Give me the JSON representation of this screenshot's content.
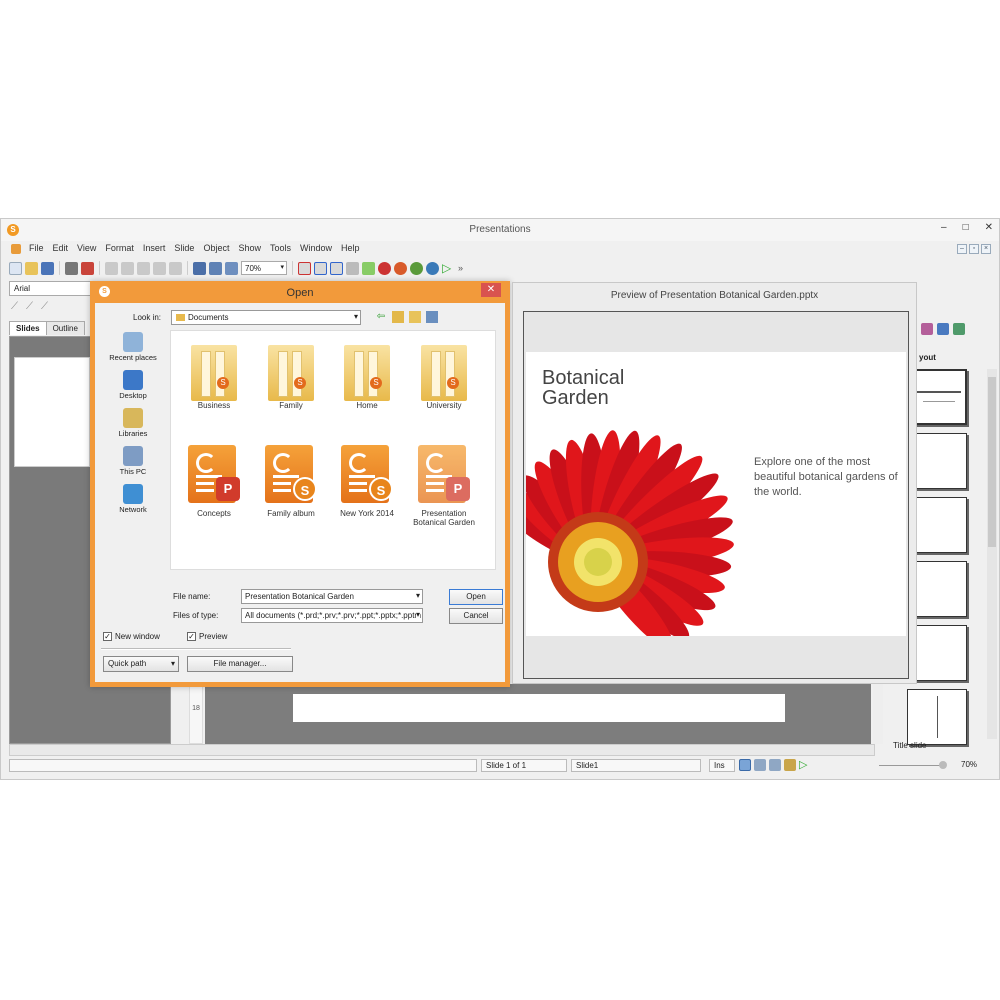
{
  "app": {
    "logo_letter": "S",
    "title": "Presentations",
    "window_buttons": [
      "–",
      "□",
      "✕"
    ],
    "mdi_buttons": [
      "–",
      "▫",
      "×"
    ]
  },
  "menu": {
    "items": [
      "File",
      "Edit",
      "View",
      "Format",
      "Insert",
      "Slide",
      "Object",
      "Show",
      "Tools",
      "Window",
      "Help"
    ]
  },
  "toolbar": {
    "zoom_value": "70%",
    "overflow": "»"
  },
  "format_bar": {
    "font": "Arial"
  },
  "panes": {
    "tabs": [
      "Slides",
      "Outline"
    ],
    "ruler_number": "18"
  },
  "layout_panel": {
    "title": "yout",
    "selected_label": "Title slide"
  },
  "statusbar": {
    "slide_of": "Slide 1 of 1",
    "slide_name": "Slide1",
    "mode": "Ins",
    "zoom": "70%"
  },
  "dialog": {
    "title": "Open",
    "logo_letter": "S",
    "close": "✕",
    "look_in_label": "Look in:",
    "look_in_value": "Documents",
    "places": [
      {
        "label": "Recent places",
        "color": "#8fb3d9"
      },
      {
        "label": "Desktop",
        "color": "#3c78c8"
      },
      {
        "label": "Libraries",
        "color": "#d8b75b"
      },
      {
        "label": "This PC",
        "color": "#7e9cc4"
      },
      {
        "label": "Network",
        "color": "#3f8fd3"
      }
    ],
    "folders": [
      "Business",
      "Family",
      "Home",
      "University"
    ],
    "documents": [
      {
        "label": "Concepts",
        "badge": "P"
      },
      {
        "label": "Family album",
        "badge": "S"
      },
      {
        "label": "New York 2014",
        "badge": "S"
      },
      {
        "label": "Presentation Botanical Garden",
        "badge": "P"
      }
    ],
    "file_name_label": "File name:",
    "file_name_value": "Presentation Botanical Garden",
    "file_type_label": "Files of type:",
    "file_type_value": "All documents (*.prd;*.prv;*.prv;*.ppt;*.pptx;*.pptm",
    "open_button": "Open",
    "cancel_button": "Cancel",
    "new_window_label": "New window",
    "new_window_checked": true,
    "preview_label": "Preview",
    "preview_checked": true,
    "quick_path": "Quick path",
    "file_manager": "File manager..."
  },
  "preview": {
    "title": "Preview of Presentation Botanical Garden.pptx",
    "heading": "Botanical Garden",
    "body": "Explore one of the most beautiful botanical gardens of the world.",
    "colors": {
      "petal": "#e0161b",
      "center": "#f2d43a"
    }
  },
  "colors": {
    "accent": "#f29a3b",
    "doc_orange": "#e8851c",
    "ppt_red": "#d13b2b"
  }
}
